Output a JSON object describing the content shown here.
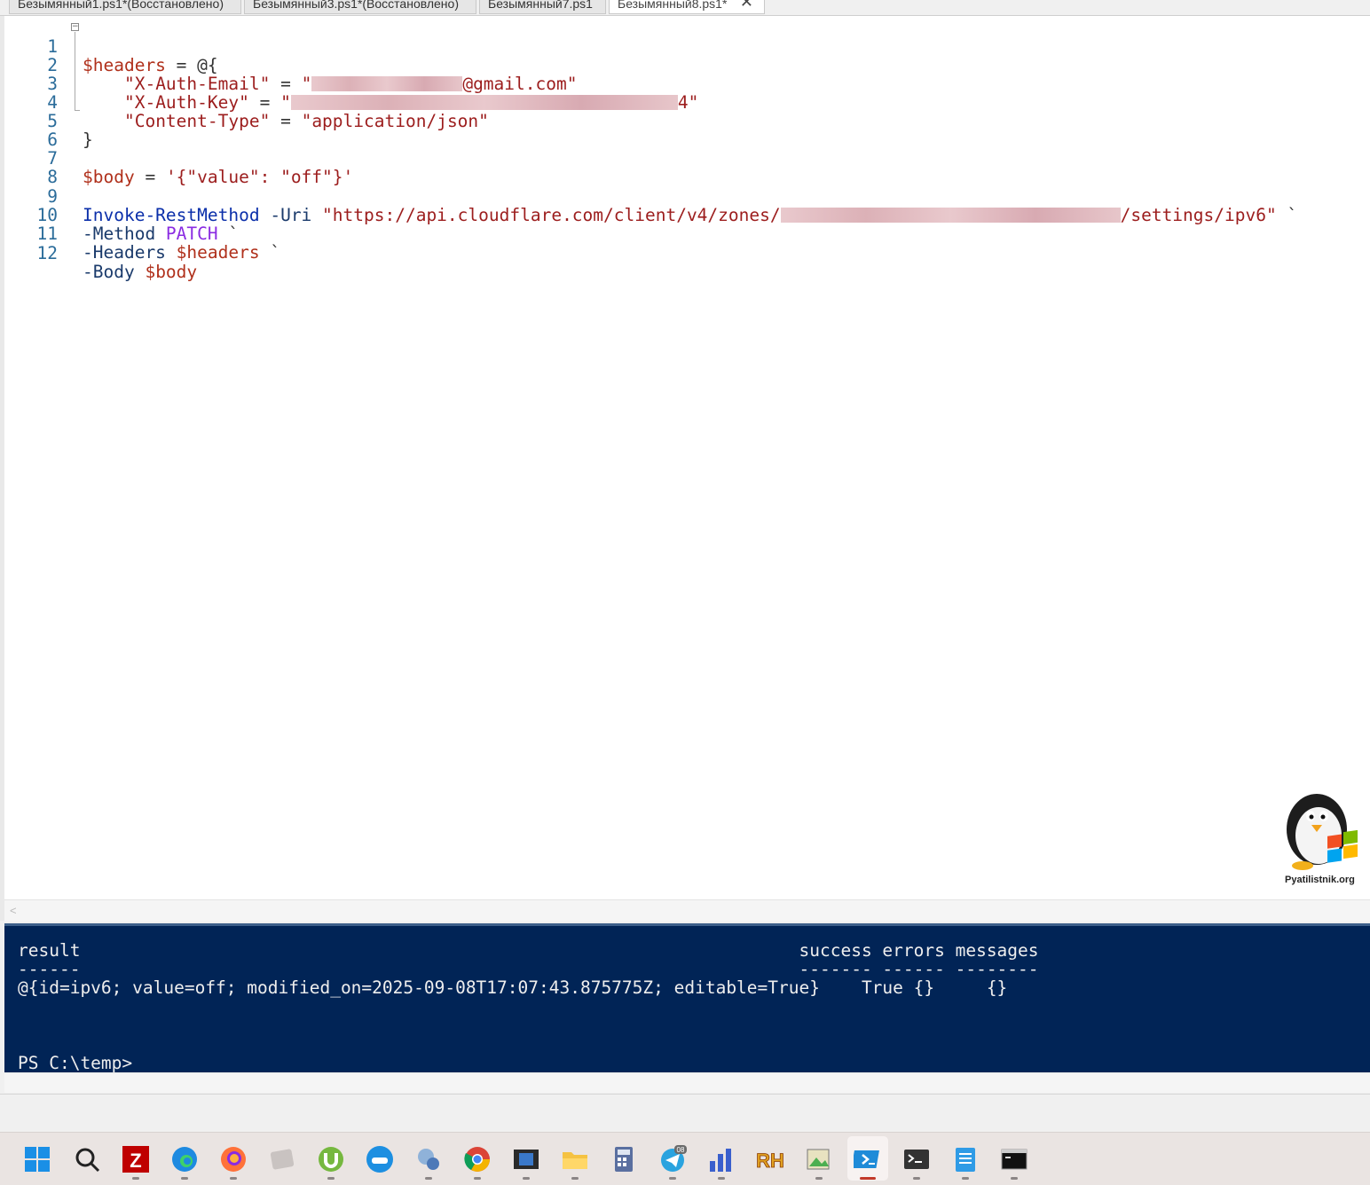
{
  "tabs": [
    {
      "label": "Безымянный1.ps1*(Восстановлено)",
      "active": false
    },
    {
      "label": "Безымянный3.ps1*(Восстановлено)",
      "active": false
    },
    {
      "label": "Безымянный7.ps1",
      "active": false
    },
    {
      "label": "Безымянный8.ps1*",
      "active": true
    }
  ],
  "tab_close_glyph": "✕",
  "editor": {
    "line_numbers": [
      "1",
      "2",
      "3",
      "4",
      "5",
      "6",
      "7",
      "8",
      "9",
      "10",
      "11",
      "12"
    ],
    "l1": {
      "var": "$headers",
      "op": " = @{"
    },
    "l2": {
      "key": "\"X-Auth-Email\"",
      "eq": " = ",
      "q": "\"",
      "tail": "@gmail.com\""
    },
    "l3": {
      "key": "\"X-Auth-Key\"",
      "eq": " = ",
      "q": "\"",
      "tail": "4\""
    },
    "l4": {
      "key": "\"Content-Type\"",
      "eq": " = ",
      "val": "\"application/json\""
    },
    "l5": {
      "text": "}"
    },
    "l7": {
      "var": "$body",
      "eq": " = ",
      "val": "'{\"value\": \"off\"}'"
    },
    "l9": {
      "cmd": "Invoke-RestMethod",
      "param": " -Uri ",
      "url_start": "\"https://api.cloudflare.com/client/v4/zones/",
      "url_end": "/settings/ipv6\"",
      "tick": " `"
    },
    "l10": {
      "param": "-Method ",
      "val": "PATCH",
      "tick": " `"
    },
    "l11": {
      "param": "-Headers ",
      "var": "$headers",
      "tick": " `"
    },
    "l12": {
      "param": "-Body ",
      "var": "$body"
    }
  },
  "logo": {
    "text": "Pyatilistnik.org"
  },
  "console": {
    "header": "result                                                                     success errors messages",
    "rule": "------                                                                     ------- ------ --------",
    "row": "@{id=ipv6; value=off; modified_on=2025-09-08T17:07:43.875775Z; editable=True}    True {}     {}",
    "prompt": "PS C:\\temp>"
  },
  "scroll_arrow": "<",
  "taskbar": {
    "icons": [
      "windows-start-icon",
      "search-icon",
      "filezilla-icon",
      "edge-icon",
      "firefox-icon",
      "app-icon",
      "utorrent-icon",
      "docker-icon",
      "network-icon",
      "chrome-icon",
      "video-editor-icon",
      "file-explorer-icon",
      "calculator-icon",
      "telegram-icon",
      "chart-app-icon",
      "rh-app-icon",
      "image-editor-icon",
      "powershell-ise-icon",
      "terminal-icon",
      "notepad-icon",
      "cmd-icon"
    ],
    "telegram_badge": "08",
    "rh_label": "RH",
    "filezilla_label": "Z"
  }
}
